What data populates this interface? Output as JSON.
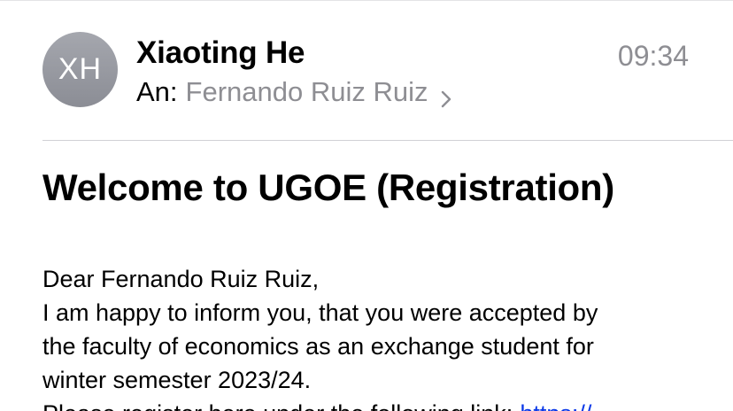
{
  "header": {
    "avatar_initials": "XH",
    "sender_name": "Xiaoting He",
    "timestamp": "09:34",
    "recipient_label": "An:",
    "recipient_name": "Fernando Ruiz Ruiz"
  },
  "email": {
    "subject": "Welcome to UGOE (Registration)",
    "body_lines": [
      "Dear Fernando Ruiz Ruiz,",
      "I am happy to inform you, that you were accepted by",
      "the faculty of economics as an exchange student for",
      "winter semester 2023/24.",
      "Please register here under the following link:"
    ],
    "link_text": "https://"
  },
  "colors": {
    "secondary_text": "#8e8e93",
    "link": "#0b39e8",
    "avatar": "#9a9ca3"
  },
  "icons": {
    "recipient_disclosure": "chevron-right-icon"
  }
}
